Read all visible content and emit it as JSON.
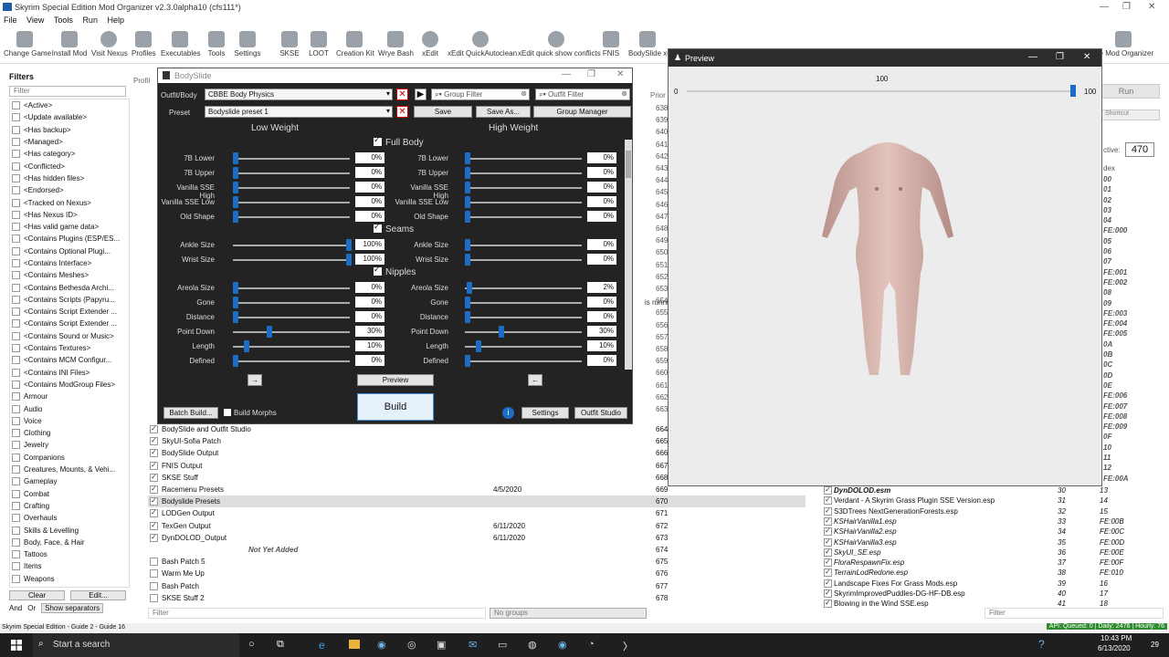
{
  "window": {
    "title": "Skyrim Special Edition Mod Organizer v2.3.0alpha10 (cfs111*)",
    "controls": [
      "—",
      "❐",
      "✕"
    ]
  },
  "menu": [
    "File",
    "View",
    "Tools",
    "Run",
    "Help"
  ],
  "toolbar": [
    "Change Game",
    "Install Mod",
    "Visit Nexus",
    "Profiles",
    "Executables",
    "Tools",
    "Settings",
    "SKSE",
    "LOOT",
    "Creation Kit",
    "Wrye Bash",
    "xEdit",
    "xEdit QuickAutoclean",
    "xEdit quick show conflicts",
    "FNIS",
    "BodySlide x64",
    "DynDOLOD",
    "",
    "",
    "",
    "",
    "",
    "",
    "",
    "",
    "",
    "ate Mod Organizer"
  ],
  "filters": {
    "heading": "Filters",
    "placeholder": "Filter",
    "items": [
      "<Active>",
      "<Update available>",
      "<Has backup>",
      "<Managed>",
      "<Has category>",
      "<Conflicted>",
      "<Has hidden files>",
      "<Endorsed>",
      "<Tracked on Nexus>",
      "<Has Nexus ID>",
      "<Has valid game data>",
      "<Contains Plugins (ESP/ES...",
      "<Contains Optional Plugi...",
      "<Contains Interface>",
      "<Contains Meshes>",
      "<Contains Bethesda Archi...",
      "<Contains Scripts (Papyru...",
      "<Contains Script Extender ...",
      "<Contains Script Extender ...",
      "<Contains Sound or Music>",
      "<Contains Textures>",
      "<Contains MCM Configur...",
      "<Contains INI Files>",
      "<Contains ModGroup Files>",
      "Armour",
      "Audio",
      "Voice",
      "Clothing",
      "Jewelry",
      "Companions",
      "Creatures, Mounts, & Vehi...",
      "Gameplay",
      "Combat",
      "Crafting",
      "Overhauls",
      "Skills & Levelling",
      "Body, Face, & Hair",
      "Tattoos",
      "Items",
      "Weapons"
    ],
    "clear": "Clear",
    "edit": "Edit...",
    "and": "And",
    "or": "Or",
    "show_sep": "Show separators"
  },
  "mods": {
    "profile_label": "Profil",
    "prior_label": "Prior",
    "rows": [
      {
        "name": "BodySlide and Outfit Studio",
        "date": "",
        "prio": "664",
        "checked": true
      },
      {
        "name": "SkyUI-Sofia Patch",
        "date": "",
        "prio": "665",
        "checked": true
      },
      {
        "name": "BodySlide Output",
        "date": "",
        "prio": "666",
        "checked": true
      },
      {
        "name": "FNIS Output",
        "date": "",
        "prio": "667",
        "checked": true
      },
      {
        "name": "SKSE Stuff",
        "date": "",
        "prio": "668",
        "checked": true
      },
      {
        "name": "Racemenu Presets",
        "date": "4/5/2020",
        "prio": "669",
        "checked": true
      },
      {
        "name": "Bodyslide Presets",
        "date": "",
        "prio": "670",
        "checked": true
      },
      {
        "name": "LODGen Output",
        "date": "",
        "prio": "671",
        "checked": true
      },
      {
        "name": "TexGen Output",
        "date": "6/11/2020",
        "prio": "672",
        "checked": true
      },
      {
        "name": "DynDOLOD_Output",
        "date": "6/11/2020",
        "prio": "673",
        "checked": true
      },
      {
        "name": "Not Yet Added",
        "date": "",
        "prio": "674",
        "checked": false
      },
      {
        "name": "Bash Patch 5",
        "date": "",
        "prio": "675",
        "checked": false
      },
      {
        "name": "Warm Me Up",
        "date": "",
        "prio": "676",
        "checked": false
      },
      {
        "name": "Bash Patch",
        "date": "",
        "prio": "677",
        "checked": false
      },
      {
        "name": "SKSE Stuff 2",
        "date": "",
        "prio": "678",
        "checked": false
      }
    ],
    "prio_top": [
      "638",
      "639",
      "640",
      "641",
      "642",
      "643",
      "644",
      "645",
      "646",
      "647",
      "648",
      "649",
      "650",
      "651",
      "652",
      "653",
      "654",
      "655",
      "656",
      "657",
      "658",
      "659",
      "660",
      "661",
      "662",
      "663"
    ],
    "running": "is running.",
    "filter_placeholder": "Filter",
    "groups": "No groups"
  },
  "plugins": {
    "run": "Run",
    "shortcut": "Shortcut",
    "active_label": "ctive:",
    "active_count": "470",
    "index_label": "dex",
    "idx_top": [
      "00",
      "01",
      "02",
      "03",
      "04",
      "FE:000",
      "05",
      "06",
      "07",
      "FE:001",
      "FE:002",
      "08",
      "09",
      "FE:003",
      "FE:004",
      "FE:005",
      "0A",
      "0B",
      "0C",
      "0D",
      "0E",
      "FE:006",
      "FE:007",
      "FE:008",
      "FE:009",
      "0F",
      "10",
      "11",
      "12",
      "FE:00A"
    ],
    "rows": [
      {
        "name": "DynDOLOD.esm",
        "prio": "30",
        "idx": "13"
      },
      {
        "name": "Verdant - A Skyrim Grass Plugin SSE Version.esp",
        "prio": "31",
        "idx": "14"
      },
      {
        "name": "S3DTrees NextGenerationForests.esp",
        "prio": "32",
        "idx": "15"
      },
      {
        "name": "KSHairVanilla1.esp",
        "prio": "33",
        "idx": "FE:00B"
      },
      {
        "name": "KSHairVanilla2.esp",
        "prio": "34",
        "idx": "FE:00C"
      },
      {
        "name": "KSHairVanilla3.esp",
        "prio": "35",
        "idx": "FE:00D"
      },
      {
        "name": "SkyUI_SE.esp",
        "prio": "36",
        "idx": "FE:00E"
      },
      {
        "name": "FloraRespawnFix.esp",
        "prio": "37",
        "idx": "FE:00F"
      },
      {
        "name": "TerrainLodRedone.esp",
        "prio": "38",
        "idx": "FE:010"
      },
      {
        "name": "Landscape Fixes For Grass Mods.esp",
        "prio": "39",
        "idx": "16"
      },
      {
        "name": "SkyrimImprovedPuddles-DG-HF-DB.esp",
        "prio": "40",
        "idx": "17"
      },
      {
        "name": "Blowing in the Wind SSE.esp",
        "prio": "41",
        "idx": "18"
      }
    ],
    "filter_placeholder": "Filter"
  },
  "bodyslide": {
    "title": "BodySlide",
    "outfit_label": "Outfit/Body",
    "outfit_value": "CBBE Body Physics",
    "preset_label": "Preset",
    "preset_value": "Bodyslide preset 1",
    "group_filter": "Group Filter",
    "outfit_filter": "Outfit Filter",
    "save": "Save",
    "save_as": "Save As...",
    "group_manager": "Group Manager",
    "low_weight": "Low Weight",
    "high_weight": "High Weight",
    "sections": [
      "Full Body",
      "Seams",
      "Nipples"
    ],
    "sliders": [
      {
        "name": "7B Lower",
        "low": 0,
        "high": 0
      },
      {
        "name": "7B Upper",
        "low": 0,
        "high": 0
      },
      {
        "name": "Vanilla SSE High",
        "low": 0,
        "high": 0
      },
      {
        "name": "Vanilla SSE Low",
        "low": 0,
        "high": 0
      },
      {
        "name": "Old Shape",
        "low": 0,
        "high": 0
      },
      {
        "name": "Ankle Size",
        "low": 100,
        "high": 0
      },
      {
        "name": "Wrist Size",
        "low": 100,
        "high": 0
      },
      {
        "name": "Areola Size",
        "low": 0,
        "high": 2
      },
      {
        "name": "Gone",
        "low": 0,
        "high": 0
      },
      {
        "name": "Distance",
        "low": 0,
        "high": 0
      },
      {
        "name": "Point Down",
        "low": 30,
        "high": 30
      },
      {
        "name": "Length",
        "low": 10,
        "high": 10
      },
      {
        "name": "Defined",
        "low": 0,
        "high": 0
      }
    ],
    "preview": "Preview",
    "build": "Build",
    "batch_build": "Batch Build...",
    "build_morphs": "Build Morphs",
    "settings": "Settings",
    "outfit_studio": "Outfit Studio",
    "arrow_left": "→",
    "arrow_right": "←"
  },
  "preview": {
    "title": "Preview",
    "min": "0",
    "mid": "100",
    "max": "100",
    "weight": 100
  },
  "status": {
    "left": "Skyrim Special Edition - Guide 2 - Guide 16",
    "right": "API: Queued: 0 | Daily: 2476 | Hourly: 76"
  },
  "taskbar": {
    "search": "Start a search",
    "time": "10:43 PM",
    "date": "6/13/2020",
    "notif": "29"
  }
}
